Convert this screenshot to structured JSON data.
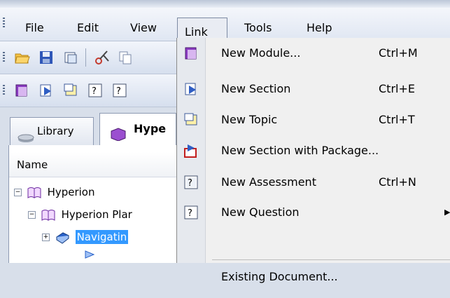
{
  "menubar": {
    "items": [
      "File",
      "Edit",
      "View",
      "Link",
      "Tools",
      "Help"
    ],
    "active": "Link"
  },
  "tabs": {
    "library": "Library",
    "hyperion": "Hype"
  },
  "tree": {
    "column_header": "Name",
    "rows": [
      "Hyperion",
      "Hyperion Plar",
      "Navigatin"
    ]
  },
  "dropdown": {
    "items": [
      {
        "label": "New Module...",
        "shortcut": "Ctrl+M",
        "icon": "module-icon"
      },
      {
        "label": "New Section",
        "shortcut": "Ctrl+E",
        "icon": "section-icon"
      },
      {
        "label": "New Topic",
        "shortcut": "Ctrl+T",
        "icon": "topic-icon"
      },
      {
        "label": "New Section with Package...",
        "shortcut": "",
        "icon": "package-icon"
      },
      {
        "label": "New Assessment",
        "shortcut": "Ctrl+N",
        "icon": "assessment-icon"
      },
      {
        "label": "New Question",
        "shortcut": "",
        "icon": "question-icon",
        "submenu_arrow": "▶"
      },
      {
        "label": "Existing Document...",
        "shortcut": "",
        "icon": ""
      }
    ]
  },
  "colors": {
    "selection": "#3399ff",
    "menu_bg": "#f0f0f0"
  }
}
